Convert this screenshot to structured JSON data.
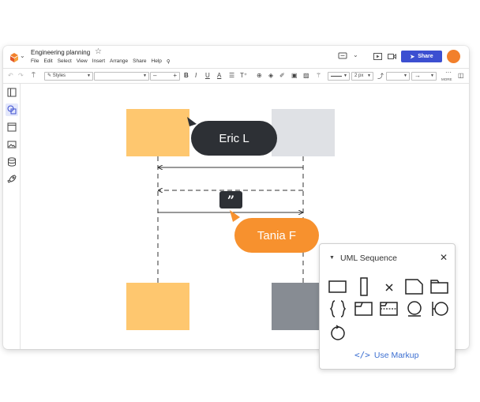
{
  "title_bar": {
    "document_title": "Engineering planning",
    "menu": [
      "File",
      "Edit",
      "Select",
      "View",
      "Insert",
      "Arrange",
      "Share",
      "Help"
    ],
    "share_label": "Share"
  },
  "toolbar": {
    "styles_label": "Styles",
    "line_width": "2 px",
    "more_label": "MORE"
  },
  "collaborators": {
    "cursor_1": "Eric L",
    "cursor_2": "Tania F"
  },
  "comment_glyph": "”",
  "panel": {
    "title": "UML Sequence",
    "use_markup_label": "Use Markup"
  },
  "colors": {
    "accent": "#3c4fd1",
    "orange": "#f7912e",
    "box_orange": "#fec76f",
    "box_light_gray": "#dfe1e5",
    "box_dark_gray": "#878c93",
    "dark_bubble": "#2d3035",
    "avatar": "#f2802b"
  }
}
